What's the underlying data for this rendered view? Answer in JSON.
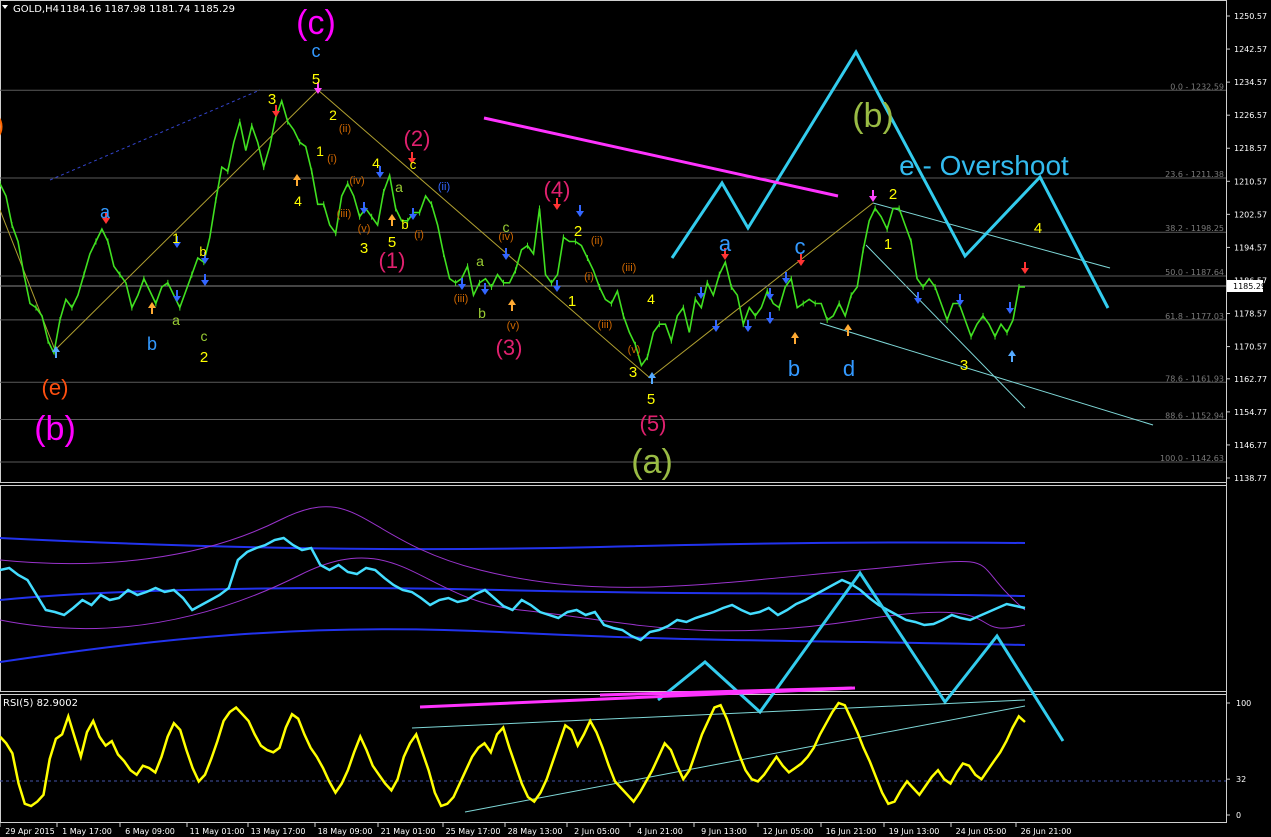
{
  "header": {
    "symbol": "GOLD,H4",
    "ohlc": "1184.16 1187.98 1181.74 1185.29"
  },
  "chart_data": [
    {
      "type": "line",
      "panel": "price",
      "symbol": "GOLD",
      "timeframe": "H4",
      "ylim": [
        1138.77,
        1250.57
      ],
      "y_ticks": [
        1250.57,
        1242.57,
        1234.57,
        1226.57,
        1218.57,
        1210.57,
        1202.57,
        1194.57,
        1186.57,
        1178.57,
        1170.57,
        1162.77,
        1154.77,
        1146.77,
        1138.77
      ],
      "current_price": "1185.29",
      "x_ticks": [
        "29 Apr 2015",
        "1 May 17:00",
        "6 May 09:00",
        "11 May 01:00",
        "13 May 17:00",
        "18 May 09:00",
        "21 May 01:00",
        "25 May 17:00",
        "28 May 13:00",
        "2 Jun 05:00",
        "4 Jun 21:00",
        "9 Jun 13:00",
        "12 Jun 05:00",
        "16 Jun 21:00",
        "19 Jun 13:00",
        "24 Jun 05:00",
        "26 Jun 21:00"
      ],
      "x_label_x": [
        30,
        87,
        150,
        217,
        278,
        345,
        408,
        473,
        535,
        597,
        660,
        724,
        788,
        851,
        914,
        981,
        1046
      ],
      "series": [
        {
          "color": "#40e020",
          "values": [
            1210,
            1207,
            1200,
            1196,
            1188,
            1181,
            1180,
            1178,
            1172,
            1169,
            1177,
            1182,
            1180,
            1183,
            1188,
            1193,
            1196,
            1199,
            1196,
            1190,
            1188,
            1186,
            1180,
            1183,
            1187,
            1184,
            1181,
            1185,
            1186,
            1183,
            1180,
            1184,
            1188,
            1192,
            1191,
            1197,
            1206,
            1214,
            1213,
            1220,
            1225,
            1218,
            1224,
            1220,
            1214,
            1219,
            1226,
            1230,
            1225,
            1223,
            1220,
            1219,
            1213,
            1205,
            1205,
            1200,
            1198,
            1207,
            1210,
            1207,
            1202,
            1204,
            1202,
            1200,
            1208,
            1212,
            1204,
            1201,
            1201,
            1203,
            1203,
            1207,
            1205,
            1200,
            1193,
            1187,
            1186,
            1187,
            1190,
            1183,
            1186,
            1187,
            1185,
            1188,
            1186,
            1186,
            1189,
            1194,
            1195,
            1193,
            1204,
            1188,
            1186,
            1188,
            1197,
            1196,
            1196,
            1195,
            1192,
            1189,
            1185,
            1182,
            1181,
            1184,
            1178,
            1174,
            1171,
            1166,
            1168,
            1174,
            1176,
            1176,
            1172,
            1178,
            1180,
            1174,
            1182,
            1180,
            1186,
            1183,
            1188,
            1191,
            1185,
            1183,
            1176,
            1180,
            1178,
            1180,
            1184,
            1181,
            1180,
            1185,
            1187,
            1180,
            1181,
            1182,
            1181,
            1181,
            1177,
            1178,
            1181,
            1178,
            1183,
            1185,
            1194,
            1201,
            1204,
            1202,
            1199,
            1204,
            1204,
            1200,
            1196,
            1187,
            1185,
            1187,
            1185,
            1181,
            1177,
            1181,
            1181,
            1177,
            1173,
            1176,
            1178,
            1176,
            1173,
            1176,
            1174,
            1177,
            1185,
            1185
          ]
        }
      ],
      "fibonacci": [
        {
          "label": "0.0 - 1232.59",
          "price": 1232.59
        },
        {
          "label": "23.6 - 1211.38",
          "price": 1211.38
        },
        {
          "label": "38.2 - 1198.25",
          "price": 1198.25
        },
        {
          "label": "50.0 - 1187.64",
          "price": 1187.64
        },
        {
          "label": "61.8 - 1177.03",
          "price": 1177.03
        },
        {
          "label": "78.6 - 1161.93",
          "price": 1161.93
        },
        {
          "label": "88.6 - 1152.94",
          "price": 1152.94
        },
        {
          "label": "100.0 - 1142.63",
          "price": 1142.63
        }
      ],
      "annotations": [
        {
          "text": ")",
          "color": "#ff6600",
          "size": 24
        },
        {
          "text": "(e)",
          "color": "#ff5010",
          "size": 22
        },
        {
          "text": "(b)",
          "color": "#ff00ff",
          "size": 34
        },
        {
          "text": "a",
          "color": "#3399ff",
          "size": 18
        },
        {
          "text": "b",
          "color": "#3399ff",
          "size": 18
        },
        {
          "text": "1",
          "color": "#ffff00",
          "size": 14
        },
        {
          "text": "a",
          "color": "#99cc33",
          "size": 14
        },
        {
          "text": "b",
          "color": "#ffff00",
          "size": 13
        },
        {
          "text": "c",
          "color": "#99cc33",
          "size": 14
        },
        {
          "text": "2",
          "color": "#ffff00",
          "size": 15
        },
        {
          "text": "3",
          "color": "#ffff00",
          "size": 15
        },
        {
          "text": "4",
          "color": "#ffff00",
          "size": 14
        },
        {
          "text": "(c)",
          "color": "#ff00ff",
          "size": 34
        },
        {
          "text": "c",
          "color": "#3399ff",
          "size": 18
        },
        {
          "text": "5",
          "color": "#ffff00",
          "size": 15
        },
        {
          "text": "2",
          "color": "#ffff00",
          "size": 14
        },
        {
          "text": "(ii)",
          "color": "#cc6600",
          "size": 11
        },
        {
          "text": "1",
          "color": "#ffff00",
          "size": 14
        },
        {
          "text": "(i)",
          "color": "#cc6600",
          "size": 11
        },
        {
          "text": "4",
          "color": "#ffff00",
          "size": 14
        },
        {
          "text": "(iv)",
          "color": "#cc6600",
          "size": 11
        },
        {
          "text": "a",
          "color": "#99cc33",
          "size": 14
        },
        {
          "text": "(iii)",
          "color": "#cc6600",
          "size": 11
        },
        {
          "text": "(v)",
          "color": "#cc6600",
          "size": 11
        },
        {
          "text": "3",
          "color": "#ffff00",
          "size": 15
        },
        {
          "text": "5",
          "color": "#ffff00",
          "size": 15
        },
        {
          "text": "b",
          "color": "#ffff00",
          "size": 13
        },
        {
          "text": "(1)",
          "color": "#e0206e",
          "size": 22
        },
        {
          "text": "(2)",
          "color": "#e0206e",
          "size": 22
        },
        {
          "text": "c",
          "color": "#ffff00",
          "size": 13
        },
        {
          "text": "(i)",
          "color": "#cc6600",
          "size": 11
        },
        {
          "text": "(ii)",
          "color": "#3366ff",
          "size": 11
        },
        {
          "text": "(iii)",
          "color": "#cc6600",
          "size": 11
        },
        {
          "text": "a",
          "color": "#99cc33",
          "size": 14
        },
        {
          "text": "b",
          "color": "#99cc33",
          "size": 14
        },
        {
          "text": "(iv)",
          "color": "#cc6600",
          "size": 11
        },
        {
          "text": "c",
          "color": "#99cc33",
          "size": 14
        },
        {
          "text": "(v)",
          "color": "#cc6600",
          "size": 11
        },
        {
          "text": "(3)",
          "color": "#e0206e",
          "size": 22
        },
        {
          "text": "(4)",
          "color": "#e0206e",
          "size": 22
        },
        {
          "text": "2",
          "color": "#ffff00",
          "size": 15
        },
        {
          "text": "(ii)",
          "color": "#cc6600",
          "size": 11
        },
        {
          "text": "(i)",
          "color": "#cc6600",
          "size": 11
        },
        {
          "text": "1",
          "color": "#ffff00",
          "size": 15
        },
        {
          "text": "(iii)",
          "color": "#cc6600",
          "size": 11
        },
        {
          "text": "4",
          "color": "#ffff00",
          "size": 14
        },
        {
          "text": "(iii)",
          "color": "#cc6600",
          "size": 11
        },
        {
          "text": "(v)",
          "color": "#cc6600",
          "size": 11
        },
        {
          "text": "3",
          "color": "#ffff00",
          "size": 15
        },
        {
          "text": "5",
          "color": "#ffff00",
          "size": 15
        },
        {
          "text": "(5)",
          "color": "#e0206e",
          "size": 22
        },
        {
          "text": "(a)",
          "color": "#99bb44",
          "size": 34
        },
        {
          "text": "a",
          "color": "#3399ff",
          "size": 22
        },
        {
          "text": "b",
          "color": "#3399ff",
          "size": 22
        },
        {
          "text": "c",
          "color": "#3399ff",
          "size": 22
        },
        {
          "text": "d",
          "color": "#3399ff",
          "size": 22
        },
        {
          "text": "(b)",
          "color": "#99bb44",
          "size": 34
        },
        {
          "text": "e - Overshoot",
          "color": "#33bbee",
          "size": 28
        },
        {
          "text": "2",
          "color": "#ffff00",
          "size": 15
        },
        {
          "text": "1",
          "color": "#ffff00",
          "size": 15
        },
        {
          "text": "4",
          "color": "#ffff00",
          "size": 15
        },
        {
          "text": "3",
          "color": "#ffff00",
          "size": 15
        }
      ]
    },
    {
      "type": "line",
      "panel": "bands",
      "series": [
        {
          "color": "#44ddff",
          "values": [
            570,
            568,
            575,
            580,
            595,
            610,
            612,
            615,
            608,
            600,
            605,
            595,
            600,
            598,
            590,
            595,
            592,
            588,
            592,
            590,
            598,
            610,
            605,
            600,
            595,
            588,
            560,
            552,
            548,
            545,
            540,
            538,
            545,
            550,
            548,
            565,
            570,
            565,
            572,
            574,
            568,
            570,
            578,
            585,
            590,
            592,
            598,
            605,
            600,
            598,
            602,
            600,
            594,
            590,
            598,
            606,
            610,
            600,
            605,
            612,
            615,
            618,
            612,
            610,
            615,
            612,
            625,
            628,
            630,
            636,
            640,
            632,
            630,
            626,
            620,
            622,
            618,
            615,
            612,
            608,
            605,
            610,
            614,
            612,
            608,
            615,
            610,
            604,
            600,
            595,
            590,
            585,
            580,
            584,
            590,
            598,
            605,
            610,
            615,
            620,
            622,
            625,
            624,
            620,
            615,
            618,
            620,
            616,
            612,
            608,
            604,
            606,
            608
          ]
        }
      ]
    },
    {
      "type": "line",
      "panel": "rsi",
      "title": "RSI(5) 82.9002",
      "ylim": [
        0,
        100
      ],
      "y_ticks": [
        100,
        32,
        0
      ],
      "series": [
        {
          "color": "#ffff00",
          "values": [
            70,
            64,
            55,
            28,
            10,
            8,
            12,
            18,
            50,
            68,
            72,
            88,
            70,
            52,
            74,
            84,
            70,
            62,
            66,
            54,
            48,
            40,
            36,
            44,
            42,
            38,
            52,
            70,
            82,
            76,
            58,
            42,
            30,
            36,
            50,
            66,
            84,
            92,
            96,
            90,
            84,
            72,
            62,
            58,
            56,
            60,
            78,
            90,
            86,
            72,
            60,
            52,
            42,
            30,
            20,
            28,
            40,
            56,
            70,
            58,
            44,
            36,
            28,
            22,
            32,
            52,
            64,
            72,
            56,
            40,
            20,
            8,
            10,
            16,
            28,
            40,
            52,
            60,
            64,
            56,
            72,
            78,
            60,
            44,
            28,
            16,
            12,
            20,
            32,
            48,
            64,
            80,
            76,
            62,
            72,
            84,
            74,
            60,
            44,
            30,
            24,
            18,
            12,
            20,
            30,
            40,
            52,
            64,
            58,
            44,
            32,
            40,
            56,
            72,
            84,
            96,
            98,
            86,
            70,
            54,
            40,
            32,
            30,
            36,
            44,
            52,
            44,
            38,
            42,
            46,
            52,
            60,
            72,
            82,
            92,
            100,
            98,
            86,
            74,
            60,
            48,
            34,
            20,
            10,
            12,
            22,
            30,
            24,
            18,
            26,
            34,
            40,
            32,
            28,
            38,
            46,
            44,
            36,
            32,
            40,
            48,
            56,
            66,
            78,
            88,
            83
          ]
        }
      ]
    }
  ]
}
